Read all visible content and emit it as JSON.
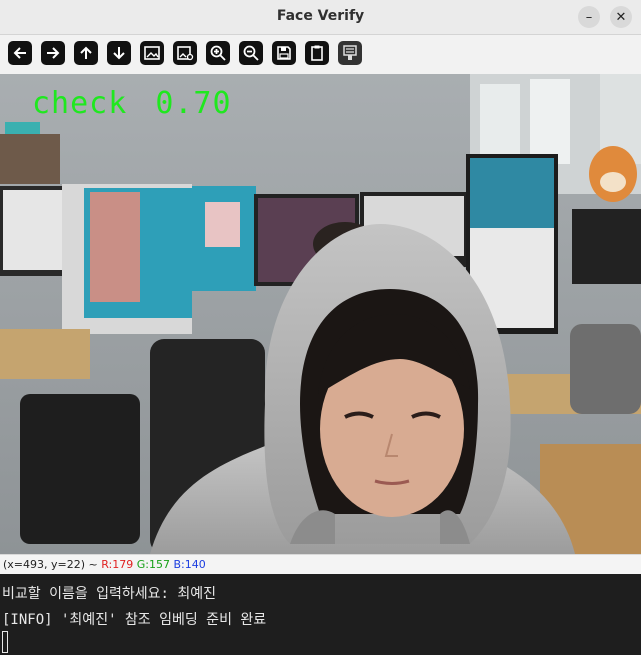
{
  "window": {
    "title": "Face Verify",
    "minimize_icon": "minimize-icon",
    "close_icon": "close-icon"
  },
  "toolbar": {
    "icons": [
      "arrow-left-icon",
      "arrow-right-icon",
      "arrow-up-icon",
      "arrow-down-icon",
      "image-icon",
      "image-settings-icon",
      "zoom-in-icon",
      "zoom-out-icon",
      "save-icon",
      "clipboard-icon",
      "properties-icon"
    ]
  },
  "viewer": {
    "overlay_label": "check",
    "overlay_score": "0.70",
    "overlay_color": "#1fe81f"
  },
  "status": {
    "coords": "(x=493, y=22) ~",
    "r": "R:179",
    "g": "G:157",
    "b": "B:140"
  },
  "terminal": {
    "line1": "비교할 이름을 입력하세요: 최예진",
    "line2": "[INFO] '최예진' 참조 임베딩 준비 완료"
  }
}
